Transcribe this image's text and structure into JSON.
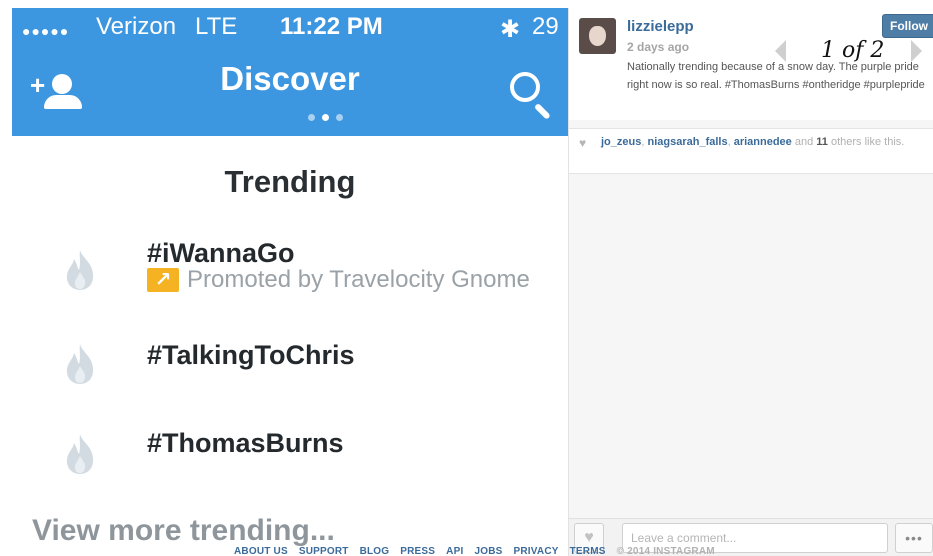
{
  "phone": {
    "status_bar": {
      "signal": "●●●●●",
      "carrier": "Verizon",
      "network": "LTE",
      "time": "11:22 PM",
      "bluetooth_icon": "bluetooth-icon",
      "battery": "29"
    },
    "header": {
      "title": "Discover",
      "add_user_icon": "add-user-icon",
      "search_icon": "search-icon",
      "page_count": 3,
      "active_page": 2
    },
    "section_title": "Trending",
    "trends": [
      {
        "tag": "#iWannaGo",
        "promoted_text": "Promoted by Travelocity Gnome",
        "icon": "flame-icon"
      },
      {
        "tag": "#TalkingToChris",
        "icon": "flame-icon"
      },
      {
        "tag": "#ThomasBurns",
        "icon": "flame-icon"
      }
    ],
    "view_more": "View more trending..."
  },
  "instagram": {
    "username": "lizzielepp",
    "time_ago": "2 days ago",
    "follow_label": "Follow",
    "caption": "Nationally trending because of a snow day. The purple pride right now is so real. #ThomasBurns #ontheridge #purplepride",
    "counter": "1 of 2",
    "likes": {
      "users": [
        "jo_zeus",
        "niagsarah_falls",
        "ariannedee"
      ],
      "connector": "and",
      "others_count": "11",
      "suffix": "others like this."
    },
    "comment_placeholder": "Leave a comment...",
    "more_label": "•••"
  },
  "footer": {
    "links": [
      "ABOUT US",
      "SUPPORT",
      "BLOG",
      "PRESS",
      "API",
      "JOBS",
      "PRIVACY",
      "TERMS"
    ],
    "copyright": "© 2014 INSTAGRAM"
  },
  "colors": {
    "twitter_blue": "#3d97e0",
    "promo_orange": "#f5b324",
    "instagram_link": "#3b6b9a",
    "follow_button": "#4e7ea6"
  }
}
